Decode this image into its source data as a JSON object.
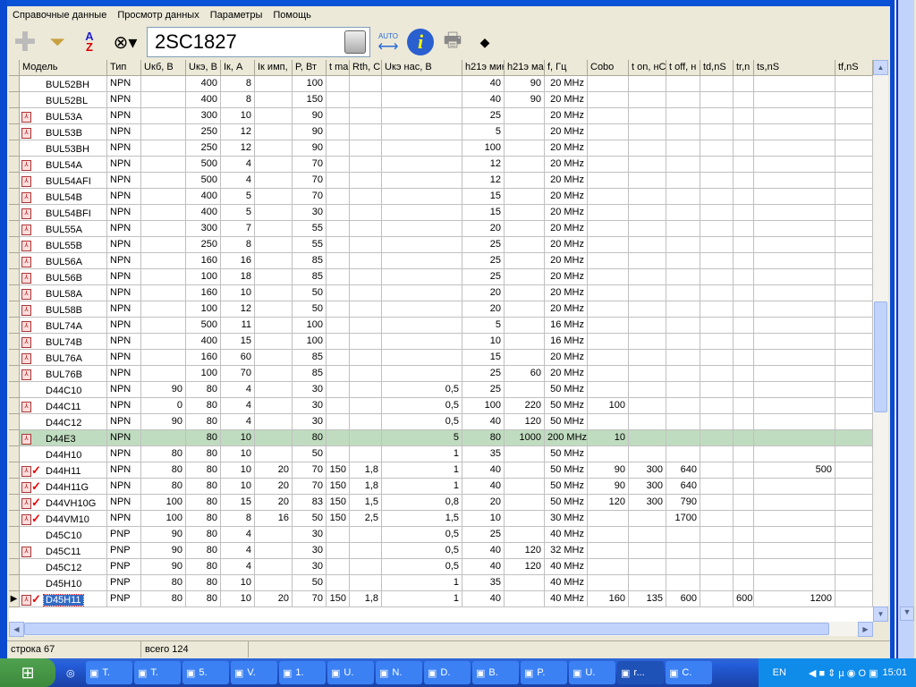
{
  "menu": [
    "Справочные данные",
    "Просмотр данных",
    "Параметры",
    "Помощь"
  ],
  "toolbar": {
    "search_value": "2SC1827",
    "auto_label": "AUTO"
  },
  "columns": [
    "Модель",
    "Тип",
    "Uкб, В",
    "Uкэ, В",
    "Iк, А",
    "Iк имп,",
    "P, Вт",
    "t ma",
    "Rth, C",
    "Uкэ нас, В",
    "h21э мин",
    "h21э ма",
    "f, Гц",
    "Cobo",
    "t on, нС",
    "t off, н",
    "td,nS",
    "tr,n",
    "ts,nS",
    "tf,nS"
  ],
  "rows": [
    {
      "pdf": false,
      "chk": false,
      "v": [
        "BUL52BH",
        "NPN",
        "",
        "400",
        "8",
        "",
        "100",
        "",
        "",
        "",
        "40",
        "90",
        "20 MHz",
        "",
        "",
        "",
        "",
        "",
        "",
        ""
      ]
    },
    {
      "pdf": false,
      "chk": false,
      "v": [
        "BUL52BL",
        "NPN",
        "",
        "400",
        "8",
        "",
        "150",
        "",
        "",
        "",
        "40",
        "90",
        "20 MHz",
        "",
        "",
        "",
        "",
        "",
        "",
        ""
      ]
    },
    {
      "pdf": true,
      "chk": false,
      "v": [
        "BUL53A",
        "NPN",
        "",
        "300",
        "10",
        "",
        "90",
        "",
        "",
        "",
        "25",
        "",
        "20 MHz",
        "",
        "",
        "",
        "",
        "",
        "",
        ""
      ]
    },
    {
      "pdf": true,
      "chk": false,
      "v": [
        "BUL53B",
        "NPN",
        "",
        "250",
        "12",
        "",
        "90",
        "",
        "",
        "",
        "5",
        "",
        "20 MHz",
        "",
        "",
        "",
        "",
        "",
        "",
        ""
      ]
    },
    {
      "pdf": false,
      "chk": false,
      "v": [
        "BUL53BH",
        "NPN",
        "",
        "250",
        "12",
        "",
        "90",
        "",
        "",
        "",
        "100",
        "",
        "20 MHz",
        "",
        "",
        "",
        "",
        "",
        "",
        ""
      ]
    },
    {
      "pdf": true,
      "chk": false,
      "v": [
        "BUL54A",
        "NPN",
        "",
        "500",
        "4",
        "",
        "70",
        "",
        "",
        "",
        "12",
        "",
        "20 MHz",
        "",
        "",
        "",
        "",
        "",
        "",
        ""
      ]
    },
    {
      "pdf": true,
      "chk": false,
      "v": [
        "BUL54AFI",
        "NPN",
        "",
        "500",
        "4",
        "",
        "70",
        "",
        "",
        "",
        "12",
        "",
        "20 MHz",
        "",
        "",
        "",
        "",
        "",
        "",
        ""
      ]
    },
    {
      "pdf": true,
      "chk": false,
      "v": [
        "BUL54B",
        "NPN",
        "",
        "400",
        "5",
        "",
        "70",
        "",
        "",
        "",
        "15",
        "",
        "20 MHz",
        "",
        "",
        "",
        "",
        "",
        "",
        ""
      ]
    },
    {
      "pdf": true,
      "chk": false,
      "v": [
        "BUL54BFI",
        "NPN",
        "",
        "400",
        "5",
        "",
        "30",
        "",
        "",
        "",
        "15",
        "",
        "20 MHz",
        "",
        "",
        "",
        "",
        "",
        "",
        ""
      ]
    },
    {
      "pdf": true,
      "chk": false,
      "v": [
        "BUL55A",
        "NPN",
        "",
        "300",
        "7",
        "",
        "55",
        "",
        "",
        "",
        "20",
        "",
        "20 MHz",
        "",
        "",
        "",
        "",
        "",
        "",
        ""
      ]
    },
    {
      "pdf": true,
      "chk": false,
      "v": [
        "BUL55B",
        "NPN",
        "",
        "250",
        "8",
        "",
        "55",
        "",
        "",
        "",
        "25",
        "",
        "20 MHz",
        "",
        "",
        "",
        "",
        "",
        "",
        ""
      ]
    },
    {
      "pdf": true,
      "chk": false,
      "v": [
        "BUL56A",
        "NPN",
        "",
        "160",
        "16",
        "",
        "85",
        "",
        "",
        "",
        "25",
        "",
        "20 MHz",
        "",
        "",
        "",
        "",
        "",
        "",
        ""
      ]
    },
    {
      "pdf": true,
      "chk": false,
      "v": [
        "BUL56B",
        "NPN",
        "",
        "100",
        "18",
        "",
        "85",
        "",
        "",
        "",
        "25",
        "",
        "20 MHz",
        "",
        "",
        "",
        "",
        "",
        "",
        ""
      ]
    },
    {
      "pdf": true,
      "chk": false,
      "v": [
        "BUL58A",
        "NPN",
        "",
        "160",
        "10",
        "",
        "50",
        "",
        "",
        "",
        "20",
        "",
        "20 MHz",
        "",
        "",
        "",
        "",
        "",
        "",
        ""
      ]
    },
    {
      "pdf": true,
      "chk": false,
      "v": [
        "BUL58B",
        "NPN",
        "",
        "100",
        "12",
        "",
        "50",
        "",
        "",
        "",
        "20",
        "",
        "20 MHz",
        "",
        "",
        "",
        "",
        "",
        "",
        ""
      ]
    },
    {
      "pdf": true,
      "chk": false,
      "v": [
        "BUL74A",
        "NPN",
        "",
        "500",
        "11",
        "",
        "100",
        "",
        "",
        "",
        "5",
        "",
        "16 MHz",
        "",
        "",
        "",
        "",
        "",
        "",
        ""
      ]
    },
    {
      "pdf": true,
      "chk": false,
      "v": [
        "BUL74B",
        "NPN",
        "",
        "400",
        "15",
        "",
        "100",
        "",
        "",
        "",
        "10",
        "",
        "16 MHz",
        "",
        "",
        "",
        "",
        "",
        "",
        ""
      ]
    },
    {
      "pdf": true,
      "chk": false,
      "v": [
        "BUL76A",
        "NPN",
        "",
        "160",
        "60",
        "",
        "85",
        "",
        "",
        "",
        "15",
        "",
        "20 MHz",
        "",
        "",
        "",
        "",
        "",
        "",
        ""
      ]
    },
    {
      "pdf": true,
      "chk": false,
      "v": [
        "BUL76B",
        "NPN",
        "",
        "100",
        "70",
        "",
        "85",
        "",
        "",
        "",
        "25",
        "60",
        "20 MHz",
        "",
        "",
        "",
        "",
        "",
        "",
        ""
      ]
    },
    {
      "pdf": false,
      "chk": false,
      "v": [
        "D44C10",
        "NPN",
        "90",
        "80",
        "4",
        "",
        "30",
        "",
        "",
        "0,5",
        "25",
        "",
        "50 MHz",
        "",
        "",
        "",
        "",
        "",
        "",
        ""
      ]
    },
    {
      "pdf": true,
      "chk": false,
      "v": [
        "D44C11",
        "NPN",
        "0",
        "80",
        "4",
        "",
        "30",
        "",
        "",
        "0,5",
        "100",
        "220",
        "50 MHz",
        "100",
        "",
        "",
        "",
        "",
        "",
        ""
      ]
    },
    {
      "pdf": false,
      "chk": false,
      "v": [
        "D44C12",
        "NPN",
        "90",
        "80",
        "4",
        "",
        "30",
        "",
        "",
        "0,5",
        "40",
        "120",
        "50 MHz",
        "",
        "",
        "",
        "",
        "",
        "",
        ""
      ]
    },
    {
      "pdf": true,
      "chk": false,
      "green": true,
      "v": [
        "D44E3",
        "NPN",
        "",
        "80",
        "10",
        "",
        "80",
        "",
        "",
        "5",
        "80",
        "1000",
        "200 MHz",
        "10",
        "",
        "",
        "",
        "",
        "",
        ""
      ]
    },
    {
      "pdf": false,
      "chk": false,
      "v": [
        "D44H10",
        "NPN",
        "80",
        "80",
        "10",
        "",
        "50",
        "",
        "",
        "1",
        "35",
        "",
        "50 MHz",
        "",
        "",
        "",
        "",
        "",
        "",
        ""
      ]
    },
    {
      "pdf": true,
      "chk": true,
      "v": [
        "D44H11",
        "NPN",
        "80",
        "80",
        "10",
        "20",
        "70",
        "150",
        "1,8",
        "1",
        "40",
        "",
        "50 MHz",
        "90",
        "300",
        "640",
        "",
        "",
        "500",
        ""
      ]
    },
    {
      "pdf": true,
      "chk": true,
      "v": [
        "D44H11G",
        "NPN",
        "80",
        "80",
        "10",
        "20",
        "70",
        "150",
        "1,8",
        "1",
        "40",
        "",
        "50 MHz",
        "90",
        "300",
        "640",
        "",
        "",
        "",
        ""
      ]
    },
    {
      "pdf": true,
      "chk": true,
      "v": [
        "D44VH10G",
        "NPN",
        "100",
        "80",
        "15",
        "20",
        "83",
        "150",
        "1,5",
        "0,8",
        "20",
        "",
        "50 MHz",
        "120",
        "300",
        "790",
        "",
        "",
        "",
        ""
      ]
    },
    {
      "pdf": true,
      "chk": true,
      "v": [
        "D44VM10",
        "NPN",
        "100",
        "80",
        "8",
        "16",
        "50",
        "150",
        "2,5",
        "1,5",
        "10",
        "",
        "30 MHz",
        "",
        "",
        "1700",
        "",
        "",
        "",
        ""
      ]
    },
    {
      "pdf": false,
      "chk": false,
      "v": [
        "D45C10",
        "PNP",
        "90",
        "80",
        "4",
        "",
        "30",
        "",
        "",
        "0,5",
        "25",
        "",
        "40 MHz",
        "",
        "",
        "",
        "",
        "",
        "",
        ""
      ]
    },
    {
      "pdf": true,
      "chk": false,
      "v": [
        "D45C11",
        "PNP",
        "90",
        "80",
        "4",
        "",
        "30",
        "",
        "",
        "0,5",
        "40",
        "120",
        "32 MHz",
        "",
        "",
        "",
        "",
        "",
        "",
        ""
      ]
    },
    {
      "pdf": false,
      "chk": false,
      "v": [
        "D45C12",
        "PNP",
        "90",
        "80",
        "4",
        "",
        "30",
        "",
        "",
        "0,5",
        "40",
        "120",
        "40 MHz",
        "",
        "",
        "",
        "",
        "",
        "",
        ""
      ]
    },
    {
      "pdf": false,
      "chk": false,
      "v": [
        "D45H10",
        "PNP",
        "80",
        "80",
        "10",
        "",
        "50",
        "",
        "",
        "1",
        "35",
        "",
        "40 MHz",
        "",
        "",
        "",
        "",
        "",
        "",
        ""
      ]
    },
    {
      "pdf": true,
      "chk": true,
      "selected": true,
      "v": [
        "D45H11",
        "PNP",
        "80",
        "80",
        "10",
        "20",
        "70",
        "150",
        "1,8",
        "1",
        "40",
        "",
        "40 MHz",
        "160",
        "135",
        "600",
        "",
        "600",
        "1200",
        ""
      ]
    }
  ],
  "status": {
    "row": "строка 67",
    "total": "всего 124"
  },
  "taskbar": {
    "items": [
      "T.",
      "T.",
      "5.",
      "V.",
      "1.",
      "U.",
      "N.",
      "D.",
      "B.",
      "P.",
      "U.",
      "r...",
      "C."
    ],
    "lang": "EN",
    "clock": "15:01"
  },
  "colors": {
    "selected_row": "#c0dcc0",
    "selection": "#316ac5"
  }
}
